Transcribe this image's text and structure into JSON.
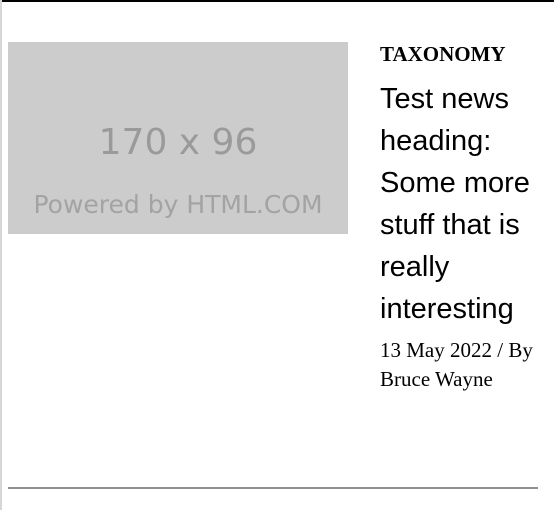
{
  "article": {
    "thumbnail": {
      "size_text": "170 x 96",
      "credit_text": "Powered by HTML.COM"
    },
    "category": "TAXONOMY",
    "headline": "Test news heading: Some more stuff that is really interesting",
    "date": "13 May 2022",
    "separator": "/",
    "byline": "By Bruce Wayne"
  }
}
